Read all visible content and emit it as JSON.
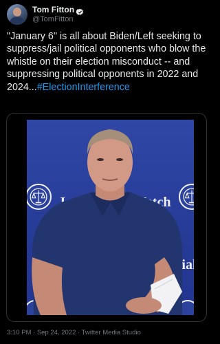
{
  "author": {
    "display_name": "Tom Fitton",
    "handle": "@TomFitton",
    "verified": true,
    "avatar_icon": "profile-photo"
  },
  "tweet": {
    "text": "\"January 6\" is all about Biden/Left seeking to suppress/jail political opponents who blow the whistle on their election misconduct -- and suppressing political opponents in 2022 and 2024...",
    "hashtag": "#ElectionInterference"
  },
  "media": {
    "type": "video",
    "backdrop_words": {
      "left": "J",
      "center": "Watch",
      "right": "icial"
    }
  },
  "meta": {
    "time": "3:10 PM",
    "separator": "·",
    "date": "Sep 24, 2022",
    "source": "Twitter Media Studio"
  },
  "colors": {
    "background": "#000000",
    "text": "#e7e9ea",
    "muted": "#71767b",
    "link": "#1d9bf0",
    "video_backdrop": "#2a3f9a"
  }
}
